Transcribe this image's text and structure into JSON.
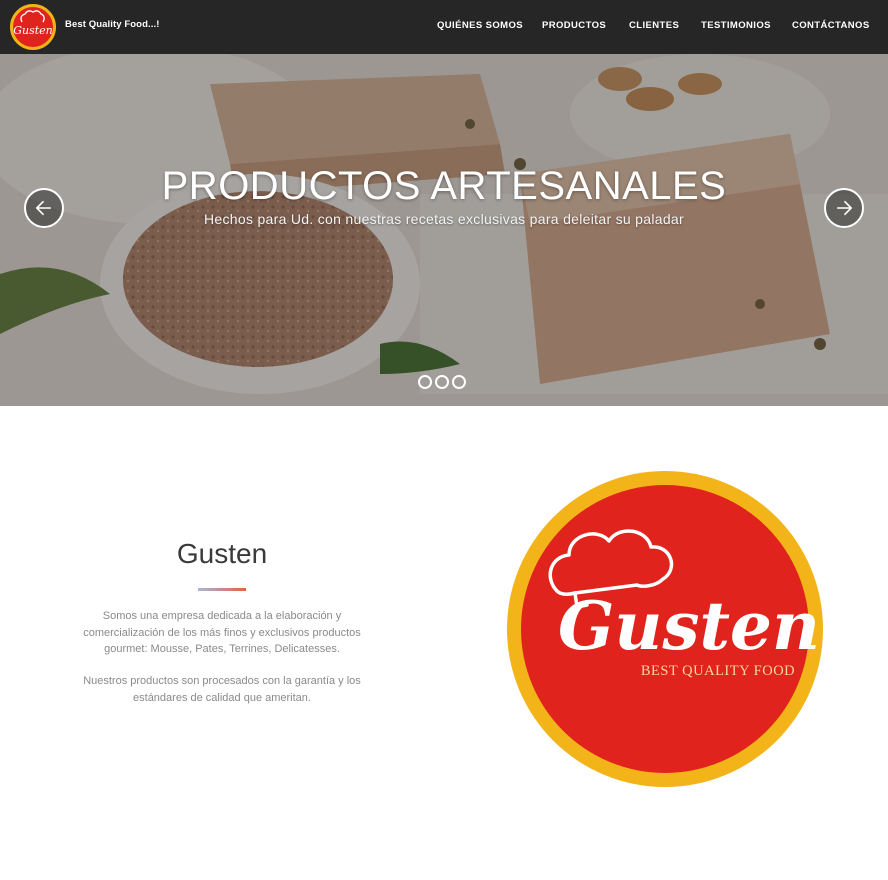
{
  "nav": {
    "brand": "Best Quality Food...!",
    "links": [
      "QUIÉNES SOMOS",
      "PRODUCTOS",
      "CLIENTES",
      "TESTIMONIOS",
      "CONTÁCTANOS"
    ]
  },
  "hero": {
    "title": "PRODUCTOS ARTESANALES",
    "subtitle": "Hechos para Ud. con nuestras recetas exclusivas para deleitar su paladar",
    "slide_count": 3,
    "prev_icon": "arrow-left-icon",
    "next_icon": "arrow-right-icon"
  },
  "about": {
    "title": "Gusten",
    "paragraph1": "Somos una empresa dedicada a la elaboración y comercialización de los más finos y exclusivos productos gourmet: Mousse, Pates, Terrines, Delicatesses.",
    "paragraph2": "Nuestros productos son procesados con la garantía y los estándares de calidad que ameritan."
  },
  "logo": {
    "wordmark": "Gusten",
    "tagline": "BEST QUALITY FOOD"
  },
  "colors": {
    "navbar": "#262626",
    "logo_red": "#e0231c",
    "logo_gold": "#f2b418",
    "divider_start": "#a8b8d8",
    "divider_end": "#e85e4a"
  }
}
